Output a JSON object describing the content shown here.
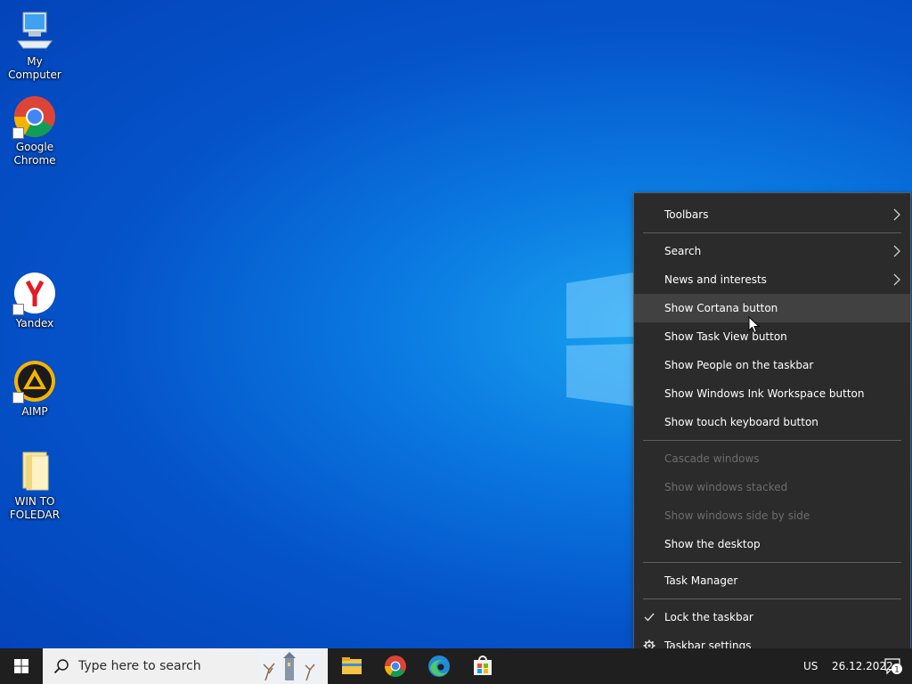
{
  "desktop": {
    "icons": [
      {
        "label": "My Computer",
        "icon": "computer-icon"
      },
      {
        "label": "Google Chrome",
        "icon": "chrome-icon"
      },
      {
        "label": "Yandex",
        "icon": "yandex-icon"
      },
      {
        "label": "AIMP",
        "icon": "aimp-icon"
      },
      {
        "label": "WIN TO FOLEDAR",
        "icon": "folder-icon"
      }
    ]
  },
  "context_menu": {
    "items": [
      {
        "label": "Toolbars"
      },
      {
        "label": "Search"
      },
      {
        "label": "News and interests"
      },
      {
        "label": "Show Cortana button"
      },
      {
        "label": "Show Task View button"
      },
      {
        "label": "Show People on the taskbar"
      },
      {
        "label": "Show Windows Ink Workspace button"
      },
      {
        "label": "Show touch keyboard button"
      },
      {
        "label": "Cascade windows"
      },
      {
        "label": "Show windows stacked"
      },
      {
        "label": "Show windows side by side"
      },
      {
        "label": "Show the desktop"
      },
      {
        "label": "Task Manager"
      },
      {
        "label": "Lock the taskbar"
      },
      {
        "label": "Taskbar settings"
      }
    ]
  },
  "taskbar": {
    "search_placeholder": "Type here to search",
    "apps": [
      "file-explorer-icon",
      "chrome-icon",
      "edge-icon",
      "store-icon"
    ],
    "tray": {
      "language": "US",
      "date": "26.12.2022",
      "notification_count": "1"
    }
  },
  "colors": {
    "menu_bg": "#2b2b2b",
    "menu_hover": "#414141",
    "menu_disabled_text": "#6d6d6d",
    "taskbar_bg": "#1f1f1f"
  }
}
